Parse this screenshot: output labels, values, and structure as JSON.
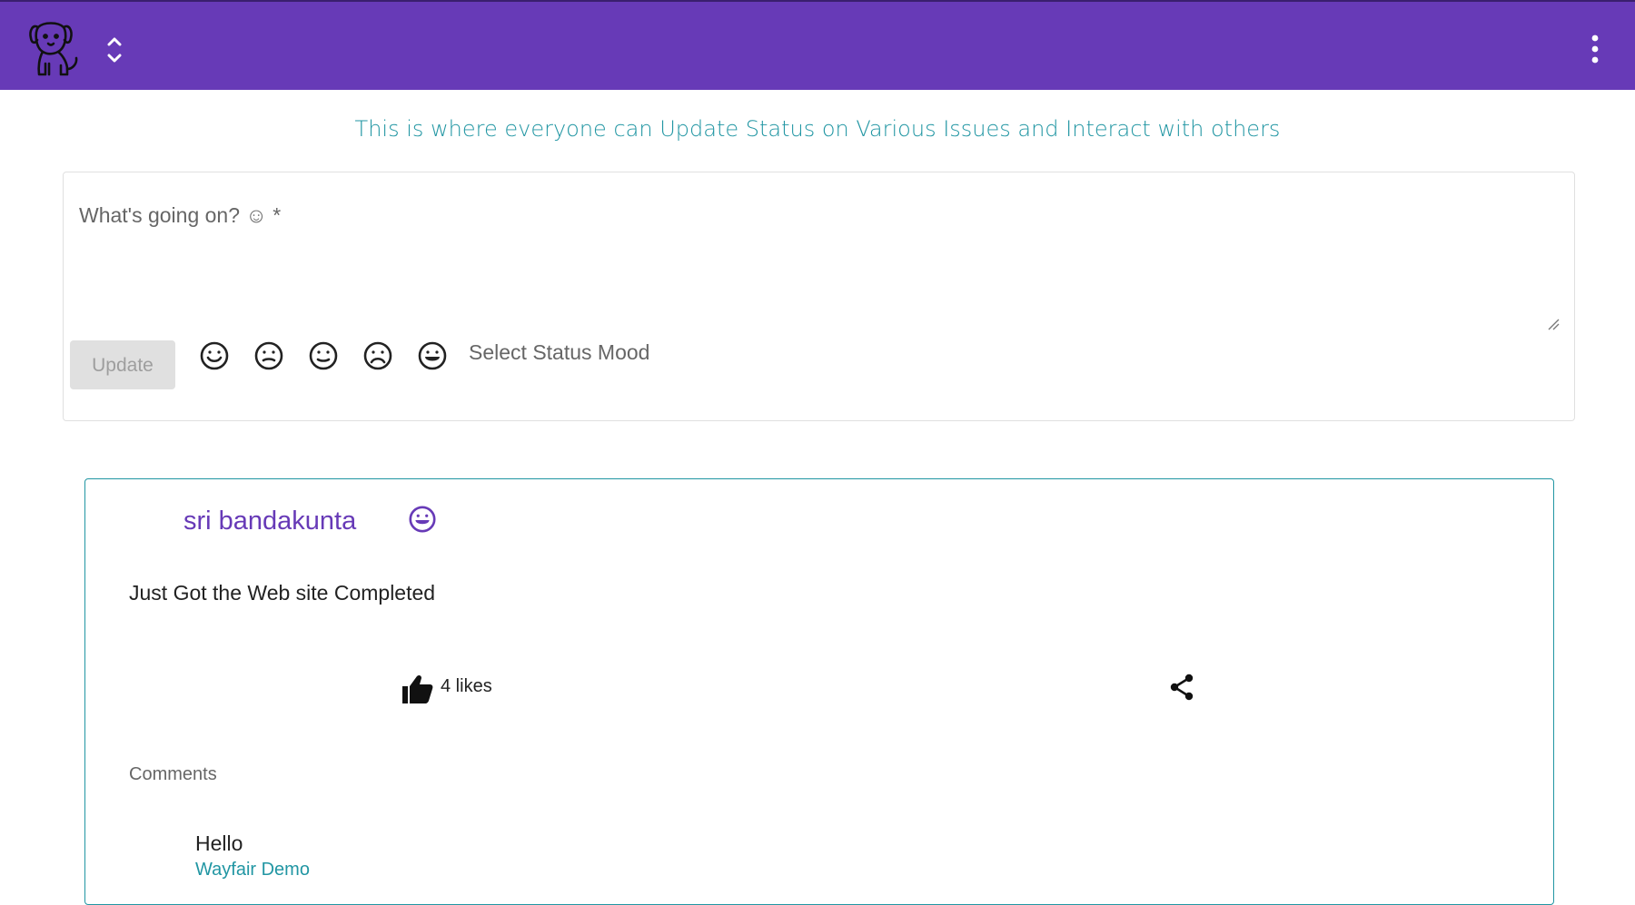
{
  "header": {
    "logo_icon": "puppy-logo-icon",
    "switcher_icon": "unfold-icon",
    "menu_icon": "more-vert-icon",
    "background": "#673ab7"
  },
  "tagline": "This is where everyone can Update Status on Various Issues and Interact with others",
  "composer": {
    "placeholder": "What's going on? ☺ *",
    "value": "",
    "update_label": "Update",
    "moods": [
      {
        "name": "smile",
        "icon": "smile-icon"
      },
      {
        "name": "neutral",
        "icon": "neutral-face-icon"
      },
      {
        "name": "slight-smile",
        "icon": "slight-smile-icon"
      },
      {
        "name": "sad",
        "icon": "sad-face-icon"
      },
      {
        "name": "grin",
        "icon": "grin-icon"
      }
    ],
    "mood_label": "Select Status Mood"
  },
  "post": {
    "author": "sri bandakunta",
    "mood_icon": "grin-icon",
    "text": "Just Got the Web site Completed",
    "likes": "4 likes",
    "like_icon": "thumb-up-icon",
    "share_icon": "share-icon",
    "comments_heading": "Comments",
    "comments": [
      {
        "text": "Hello",
        "author": "Wayfair Demo"
      }
    ]
  },
  "colors": {
    "accent": "#673ab7",
    "teal": "#2196a3"
  }
}
